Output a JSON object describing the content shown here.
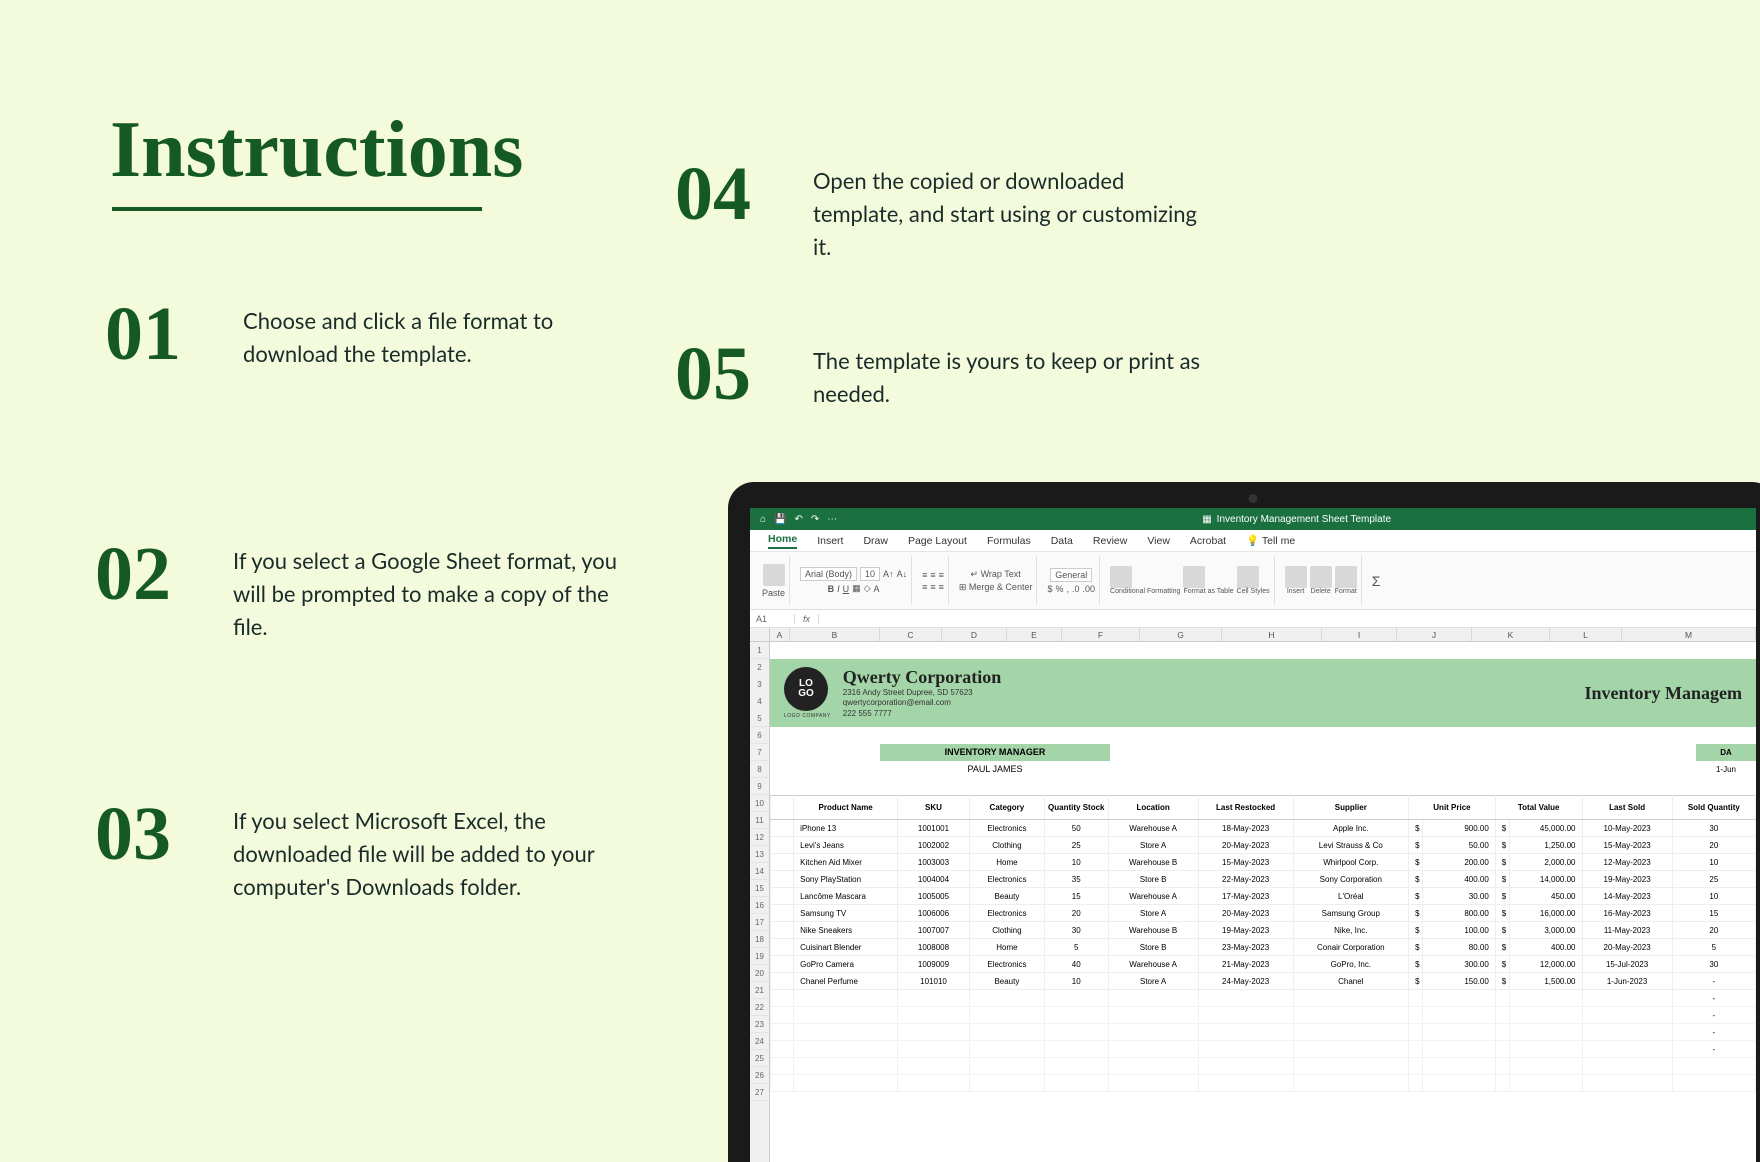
{
  "title": "Instructions",
  "steps": {
    "s01": {
      "num": "01",
      "text": "Choose and click a file format to download the template."
    },
    "s02": {
      "num": "02",
      "text": "If you select a Google Sheet format, you will be prompted to make a copy of the file."
    },
    "s03": {
      "num": "03",
      "text": "If you select Microsoft Excel, the downloaded file will be added to your computer's Downloads folder."
    },
    "s04": {
      "num": "04",
      "text": "Open the copied or downloaded template, and start using or customizing it."
    },
    "s05": {
      "num": "05",
      "text": "The template is yours to keep or print as needed."
    }
  },
  "excel": {
    "window_title": "Inventory Management Sheet Template",
    "tabs": [
      "Home",
      "Insert",
      "Draw",
      "Page Layout",
      "Formulas",
      "Data",
      "Review",
      "View",
      "Acrobat",
      "Tell me"
    ],
    "font_name": "Arial (Body)",
    "font_size": "10",
    "wrap": "Wrap Text",
    "merge": "Merge & Center",
    "num_format": "General",
    "cond": "Conditional Formatting",
    "fmt_tbl": "Format as Table",
    "cell_styles": "Cell Styles",
    "insert": "Insert",
    "delete": "Delete",
    "format": "Format",
    "namebox": "A1",
    "fx": "fx",
    "cols": [
      "A",
      "B",
      "C",
      "D",
      "E",
      "F",
      "G",
      "H",
      "I",
      "J",
      "K",
      "L",
      "M"
    ],
    "company": {
      "logo_top": "LO",
      "logo_bot": "GO",
      "logo_sub": "LOGO COMPANY",
      "name": "Qwerty Corporation",
      "addr": "2316 Andy Street Dupree, SD 57623",
      "email": "qwertycorporation@email.com",
      "phone": "222 555 7777",
      "sheet_title": "Inventory Managem"
    },
    "manager_label": "INVENTORY MANAGER",
    "manager_name": "PAUL JAMES",
    "date_label": "DA",
    "date_val": "1-Jun",
    "headers": [
      "Product Name",
      "SKU",
      "Category",
      "Quantity Stock",
      "Location",
      "Last Restocked",
      "Supplier",
      "Unit Price",
      "Total Value",
      "Last Sold",
      "Sold Quantity"
    ],
    "rows": [
      {
        "p": "iPhone 13",
        "sku": "1001001",
        "cat": "Electronics",
        "q": "50",
        "loc": "Warehouse A",
        "lr": "18-May-2023",
        "sup": "Apple Inc.",
        "up": "900.00",
        "tv": "45,000.00",
        "ls": "10-May-2023",
        "sq": "30"
      },
      {
        "p": "Levi's Jeans",
        "sku": "1002002",
        "cat": "Clothing",
        "q": "25",
        "loc": "Store A",
        "lr": "20-May-2023",
        "sup": "Levi Strauss & Co",
        "up": "50.00",
        "tv": "1,250.00",
        "ls": "15-May-2023",
        "sq": "20"
      },
      {
        "p": "Kitchen Aid Mixer",
        "sku": "1003003",
        "cat": "Home",
        "q": "10",
        "loc": "Warehouse B",
        "lr": "15-May-2023",
        "sup": "Whirlpool Corp.",
        "up": "200.00",
        "tv": "2,000.00",
        "ls": "12-May-2023",
        "sq": "10"
      },
      {
        "p": "Sony PlayStation",
        "sku": "1004004",
        "cat": "Electronics",
        "q": "35",
        "loc": "Store B",
        "lr": "22-May-2023",
        "sup": "Sony Corporation",
        "up": "400.00",
        "tv": "14,000.00",
        "ls": "19-May-2023",
        "sq": "25"
      },
      {
        "p": "Lancôme Mascara",
        "sku": "1005005",
        "cat": "Beauty",
        "q": "15",
        "loc": "Warehouse A",
        "lr": "17-May-2023",
        "sup": "L'Oréal",
        "up": "30.00",
        "tv": "450.00",
        "ls": "14-May-2023",
        "sq": "10"
      },
      {
        "p": "Samsung TV",
        "sku": "1006006",
        "cat": "Electronics",
        "q": "20",
        "loc": "Store A",
        "lr": "20-May-2023",
        "sup": "Samsung Group",
        "up": "800.00",
        "tv": "16,000.00",
        "ls": "16-May-2023",
        "sq": "15"
      },
      {
        "p": "Nike Sneakers",
        "sku": "1007007",
        "cat": "Clothing",
        "q": "30",
        "loc": "Warehouse B",
        "lr": "19-May-2023",
        "sup": "Nike, Inc.",
        "up": "100.00",
        "tv": "3,000.00",
        "ls": "11-May-2023",
        "sq": "20"
      },
      {
        "p": "Cuisinart Blender",
        "sku": "1008008",
        "cat": "Home",
        "q": "5",
        "loc": "Store B",
        "lr": "23-May-2023",
        "sup": "Conair Corporation",
        "up": "80.00",
        "tv": "400.00",
        "ls": "20-May-2023",
        "sq": "5"
      },
      {
        "p": "GoPro Camera",
        "sku": "1009009",
        "cat": "Electronics",
        "q": "40",
        "loc": "Warehouse A",
        "lr": "21-May-2023",
        "sup": "GoPro, Inc.",
        "up": "300.00",
        "tv": "12,000.00",
        "ls": "15-Jul-2023",
        "sq": "30"
      },
      {
        "p": "Chanel Perfume",
        "sku": "101010",
        "cat": "Beauty",
        "q": "10",
        "loc": "Store A",
        "lr": "24-May-2023",
        "sup": "Chanel",
        "up": "150.00",
        "tv": "1,500.00",
        "ls": "1-Jun-2023",
        "sq": "-"
      }
    ]
  }
}
